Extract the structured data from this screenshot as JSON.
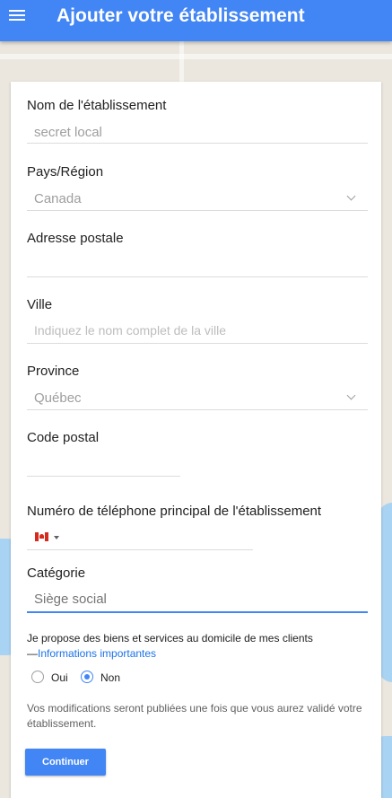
{
  "header": {
    "title": "Ajouter votre établissement",
    "menu_icon": "menu-icon",
    "color": "#4285f4"
  },
  "form": {
    "name": {
      "label": "Nom de l'établissement",
      "value": "secret local"
    },
    "country": {
      "label": "Pays/Région",
      "value": "Canada"
    },
    "address": {
      "label": "Adresse postale",
      "value": ""
    },
    "city": {
      "label": "Ville",
      "placeholder": "Indiquez le nom complet de la ville"
    },
    "province": {
      "label": "Province",
      "value": "Québec"
    },
    "postal": {
      "label": "Code postal",
      "value": ""
    },
    "phone": {
      "label": "Numéro de téléphone principal de l'établissement",
      "value": "",
      "flag_icon": "canada-flag-icon"
    },
    "category": {
      "label": "Catégorie",
      "value": "Siège social"
    },
    "service": {
      "text": "Je propose des biens et services au domicile de mes clients",
      "dash": "—",
      "link": "Informations importantes",
      "options": [
        "Oui",
        "Non"
      ],
      "selected": "Non"
    },
    "notice": "Vos modifications seront publiées une fois que vous aurez validé votre établissement.",
    "submit_label": "Continuer"
  }
}
